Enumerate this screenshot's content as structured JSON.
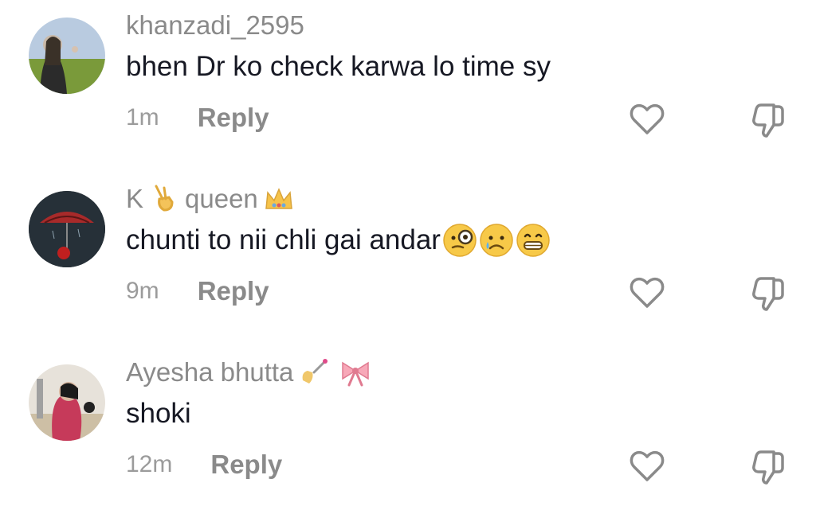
{
  "comments": [
    {
      "username": "khanzadi_2595",
      "username_suffix": "",
      "text": "bhen Dr ko check karwa lo time sy",
      "time": "1m",
      "reply_label": "Reply",
      "emojis": []
    },
    {
      "username": "K",
      "username_suffix": "queen",
      "text": "chunti to nii chli gai andar",
      "time": "9m",
      "reply_label": "Reply",
      "emojis": [
        "monocle-face",
        "sad-tear-face",
        "grinning-face"
      ]
    },
    {
      "username": "Ayesha bhutta",
      "username_suffix": "",
      "text": "shoki",
      "time": "12m",
      "reply_label": "Reply",
      "emojis": []
    }
  ],
  "colors": {
    "username": "#8a8a8a",
    "text": "#161823",
    "meta": "#9b9b9b",
    "icon_stroke": "#8a8a8a"
  },
  "icons": {
    "like": "heart-outline-icon",
    "dislike": "thumbs-down-outline-icon"
  }
}
